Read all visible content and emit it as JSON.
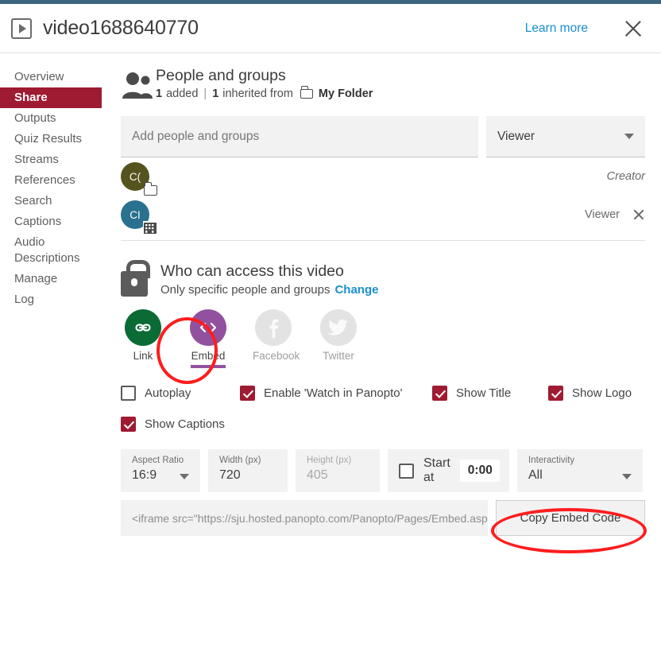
{
  "header": {
    "play_icon": "play-icon",
    "title": "video1688640770",
    "learn_more": "Learn more",
    "close_icon": "close-icon"
  },
  "sidebar": {
    "items": [
      {
        "label": "Overview",
        "active": false
      },
      {
        "label": "Share",
        "active": true
      },
      {
        "label": "Outputs",
        "active": false
      },
      {
        "label": "Quiz Results",
        "active": false
      },
      {
        "label": "Streams",
        "active": false
      },
      {
        "label": "References",
        "active": false
      },
      {
        "label": "Search",
        "active": false
      },
      {
        "label": "Captions",
        "active": false
      },
      {
        "label": "Audio Descriptions",
        "active": false
      },
      {
        "label": "Manage",
        "active": false
      },
      {
        "label": "Log",
        "active": false
      }
    ],
    "active_color": "#9e1b32"
  },
  "people": {
    "icon": "people-icon",
    "title": "People and groups",
    "added_count": "1",
    "added_word": "added",
    "separator": "|",
    "inherited_count": "1",
    "inherited_word": "inherited from",
    "folder_icon": "folder-icon",
    "folder_name": "My Folder",
    "add_placeholder": "Add people and groups",
    "role_selected": "Viewer",
    "members": [
      {
        "initials": "C(",
        "avatar_color": "#55541f",
        "badge": "folder-badge",
        "role": "Creator",
        "removable": false
      },
      {
        "initials": "CI",
        "avatar_color": "#2a708f",
        "badge": "building-badge",
        "role": "Viewer",
        "removable": true
      }
    ]
  },
  "access": {
    "lock_icon": "lock-icon",
    "title": "Who can access this video",
    "subtitle": "Only specific people and groups",
    "change_label": "Change",
    "change_color": "#1a8fd0",
    "targets": [
      {
        "name": "link",
        "label": "Link",
        "icon": "link-icon",
        "color": "#0a6b35",
        "selected": false,
        "disabled": false
      },
      {
        "name": "embed",
        "label": "Embed",
        "icon": "code-icon",
        "color": "#91519e",
        "selected": true,
        "disabled": false
      },
      {
        "name": "facebook",
        "label": "Facebook",
        "icon": "facebook-icon",
        "color": "#e3e3e3",
        "selected": false,
        "disabled": true
      },
      {
        "name": "twitter",
        "label": "Twitter",
        "icon": "twitter-icon",
        "color": "#e3e3e3",
        "selected": false,
        "disabled": true
      }
    ]
  },
  "options": {
    "checkboxes": [
      {
        "name": "autoplay",
        "label": "Autoplay",
        "checked": false
      },
      {
        "name": "watch-panopto",
        "label": "Enable 'Watch in Panopto'",
        "checked": true
      },
      {
        "name": "show-title",
        "label": "Show Title",
        "checked": true
      },
      {
        "name": "show-logo",
        "label": "Show Logo",
        "checked": true
      },
      {
        "name": "show-captions",
        "label": "Show Captions",
        "checked": true
      }
    ],
    "aspect_ratio": {
      "label": "Aspect Ratio",
      "value": "16:9"
    },
    "width": {
      "label": "Width (px)",
      "value": "720"
    },
    "height": {
      "label": "Height (px)",
      "value": "405",
      "disabled": true
    },
    "start_at": {
      "label": "Start at",
      "value": "0:00",
      "checked": false
    },
    "interactivity": {
      "label": "Interactivity",
      "value": "All"
    },
    "checked_color": "#9e1b32"
  },
  "embed": {
    "code": "<iframe src=\"https://sju.hosted.panopto.com/Panopto/Pages/Embed.aspx'",
    "copy_label": "Copy Embed Code"
  },
  "annotations": {
    "color": "#fe1d1d",
    "marks": [
      "embed-target-highlight",
      "copy-embed-code-highlight"
    ]
  }
}
